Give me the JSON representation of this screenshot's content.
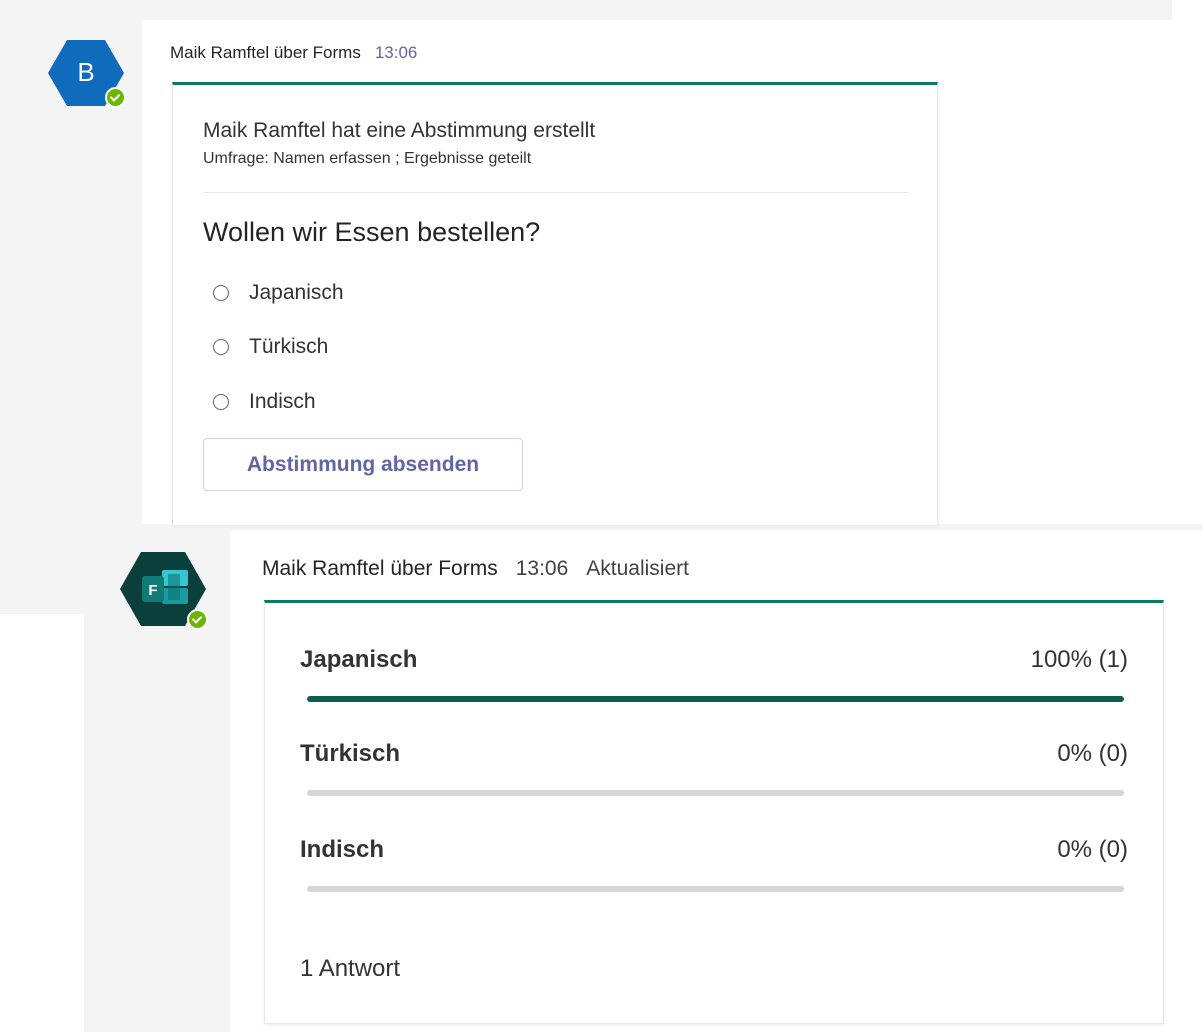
{
  "poll_message": {
    "avatar_letter": "B",
    "sender": "Maik Ramftel über Forms",
    "time": "13:06",
    "title": "Maik Ramftel hat eine Abstimmung erstellt",
    "subtitle": "Umfrage: Namen erfassen ; Ergebnisse geteilt",
    "question": "Wollen wir Essen bestellen?",
    "options": [
      "Japanisch",
      "Türkisch",
      "Indisch"
    ],
    "submit_label": "Abstimmung absenden"
  },
  "results_message": {
    "avatar_icon": "forms-app-icon",
    "sender": "Maik Ramftel über Forms",
    "time": "13:06",
    "status": "Aktualisiert",
    "results": [
      {
        "label": "Japanisch",
        "value_text": "100% (1)",
        "percent": 100
      },
      {
        "label": "Türkisch",
        "value_text": "0% (0)",
        "percent": 0
      },
      {
        "label": "Indisch",
        "value_text": "0% (0)",
        "percent": 0
      }
    ],
    "answers_text": "1 Antwort"
  },
  "colors": {
    "accent_teal": "#117865",
    "bar_fill": "#0e5e4f",
    "avatar_blue": "#0f6cbd",
    "presence_green": "#6bb700",
    "button_text": "#6264a7"
  }
}
